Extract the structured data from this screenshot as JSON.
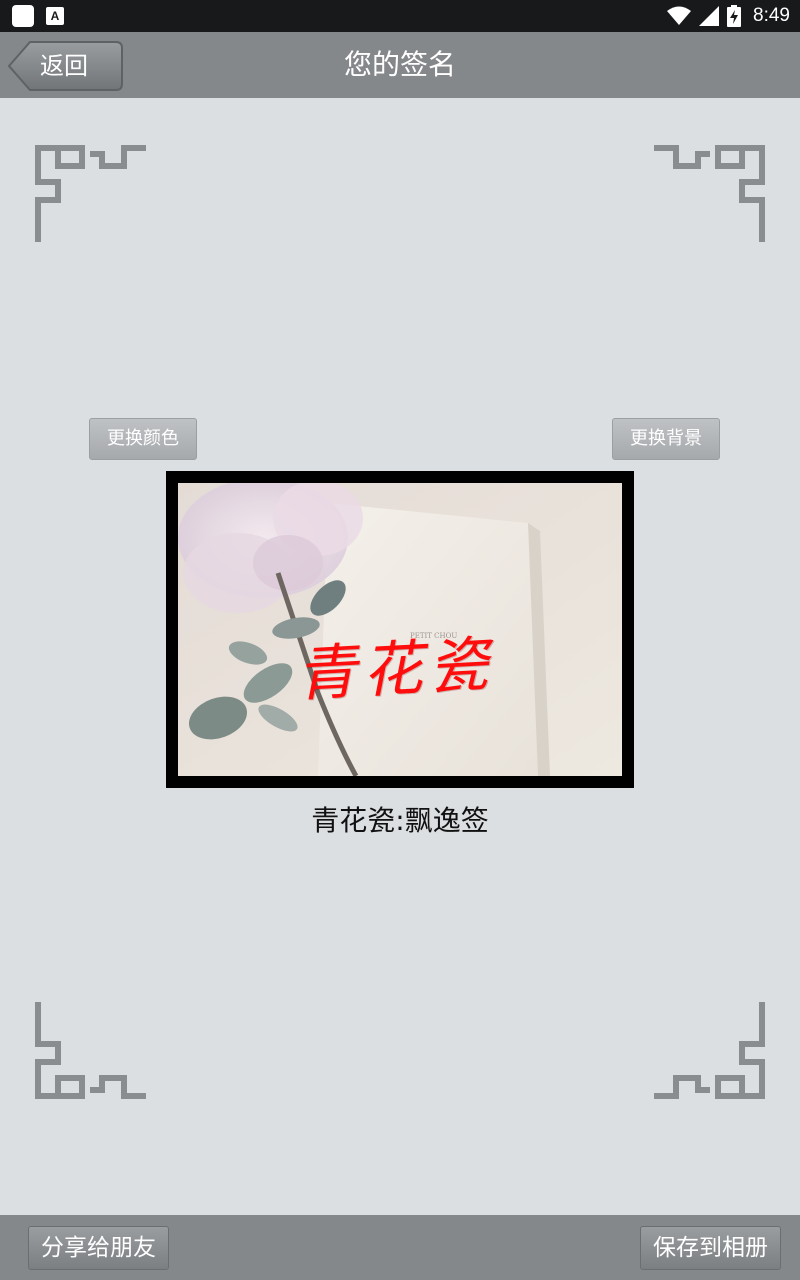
{
  "status_bar": {
    "time": "8:49",
    "app_icon_letter": "A",
    "icons": [
      "app-icon",
      "notification-a-icon",
      "wifi-icon",
      "signal-icon",
      "battery-charging-icon"
    ]
  },
  "header": {
    "back_label": "返回",
    "title": "您的签名"
  },
  "controls": {
    "change_color_label": "更换颜色",
    "change_background_label": "更换背景"
  },
  "signature": {
    "text": "青花瓷",
    "color": "#ff0c0c",
    "caption": "青花瓷:飘逸签"
  },
  "bottom_bar": {
    "share_label": "分享给朋友",
    "save_label": "保存到相册"
  },
  "colors": {
    "background": "#dcdfe2",
    "bar": "#85888b",
    "status_bar": "#17191b"
  }
}
